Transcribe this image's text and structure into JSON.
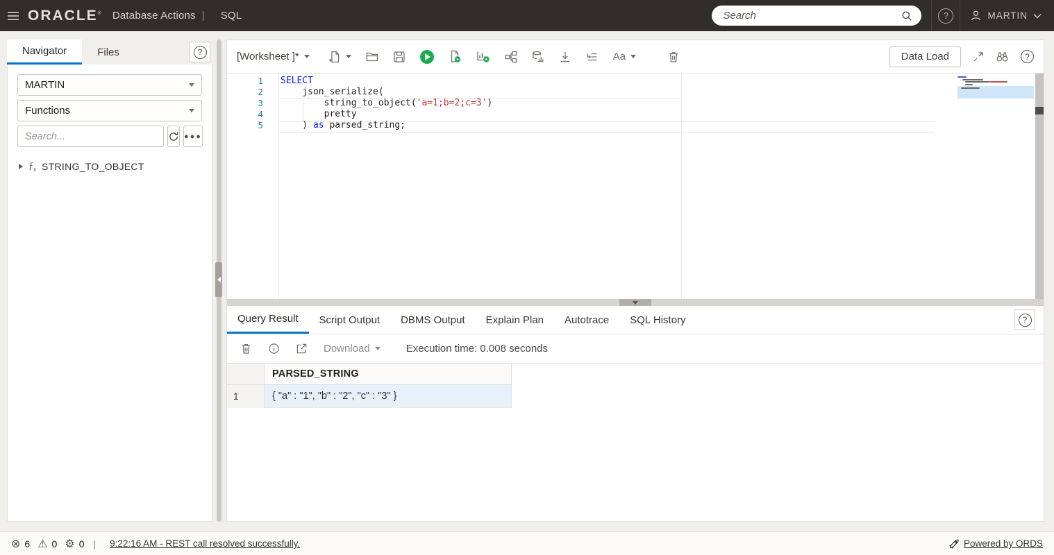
{
  "topbar": {
    "brand": "ORACLE",
    "brand_mark": "®",
    "title": "Database Actions",
    "separator": "|",
    "section": "SQL",
    "search_placeholder": "Search",
    "user": "MARTIN"
  },
  "sidebar": {
    "tabs": [
      {
        "label": "Navigator",
        "active": true
      },
      {
        "label": "Files",
        "active": false
      }
    ],
    "schema_select_value": "MARTIN",
    "object_type_select_value": "Functions",
    "search_placeholder": "Search...",
    "tree_items": [
      {
        "icon": "function-fx",
        "label": "STRING_TO_OBJECT"
      }
    ]
  },
  "worksheet": {
    "tab_label": "[Worksheet ]*",
    "toolbar_icons": [
      "new-file",
      "open-file",
      "save",
      "run-statement",
      "run-script",
      "autotrace",
      "explain-plan",
      "db-metrics",
      "download",
      "indent",
      "text-case",
      "clear"
    ],
    "text_case_label": "Aa",
    "data_load_label": "Data Load",
    "right_icons": [
      "expand",
      "find",
      "help"
    ],
    "code_lines": [
      {
        "num": "1",
        "s": [
          {
            "t": "SELECT"
          }
        ]
      },
      {
        "num": "2",
        "s": [
          {
            "t": "    json_serialize("
          }
        ]
      },
      {
        "num": "3",
        "s": [
          {
            "t": "        string_to_object("
          },
          {
            "t": "'a=1;b=2;c=3'"
          },
          {
            "t": ")"
          }
        ]
      },
      {
        "num": "4",
        "s": [
          {
            "t": "        pretty"
          }
        ]
      },
      {
        "num": "5",
        "s": [
          {
            "t": "    ) "
          },
          {
            "t": "as"
          },
          {
            "t": " parsed_string;"
          }
        ]
      }
    ]
  },
  "results": {
    "tabs": [
      "Query Result",
      "Script Output",
      "DBMS Output",
      "Explain Plan",
      "Autotrace",
      "SQL History"
    ],
    "active_tab": "Query Result",
    "toolbar_icons": [
      "clear",
      "info",
      "open-in-new"
    ],
    "download_label": "Download",
    "execution_time": "Execution time: 0.008 seconds",
    "table": {
      "columns": [
        "PARSED_STRING"
      ],
      "rows": [
        {
          "num": "1",
          "value": "{ \"a\" : \"1\", \"b\" : \"2\", \"c\" : \"3\" }"
        }
      ]
    }
  },
  "statusbar": {
    "error_count": "6",
    "warning_count": "0",
    "process_count": "0",
    "message": "9:22:16 AM - REST call resolved successfully.",
    "powered_by": "Powered by ORDS"
  },
  "colors": {
    "topbar_bg": "#312d2a",
    "accent_blue": "#0572ce",
    "run_green": "#1cab4f",
    "keyword_blue": "#0d1fd0",
    "string_red": "#b5392a",
    "line_number_teal": "#2d7d9a",
    "selected_row_bg": "#e8f1fa",
    "page_bg": "#f1efec"
  }
}
